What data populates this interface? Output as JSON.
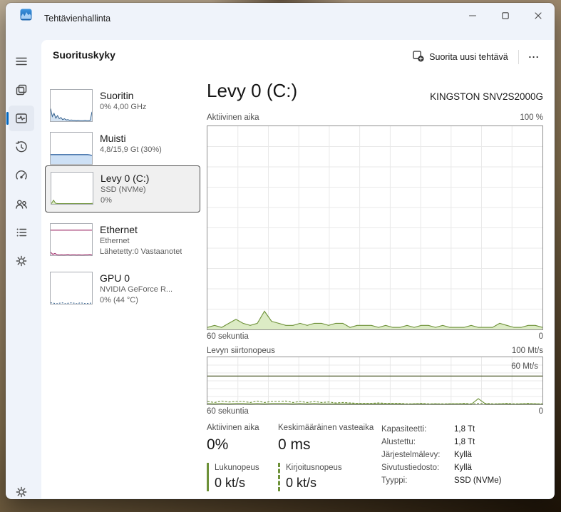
{
  "titlebar": {
    "title": "Tehtävienhallinta"
  },
  "window_controls": [
    "minimize",
    "maximize",
    "close"
  ],
  "header": {
    "title": "Suorituskyky",
    "run_new_task_label": "Suorita uusi tehtävä",
    "more_label": "..."
  },
  "sidebar": {
    "items": [
      "menu",
      "processes",
      "performance",
      "app-history",
      "startup-apps",
      "users",
      "details",
      "services"
    ],
    "bottom": "settings",
    "selected": "performance"
  },
  "perf_list": [
    {
      "name": "Suoritin",
      "line2": "0% 4,00 GHz",
      "type": "cpu",
      "spark": [
        40,
        15,
        25,
        10,
        18,
        8,
        12,
        5,
        8,
        4,
        5,
        3,
        4,
        3,
        3,
        2,
        3,
        2,
        2,
        2,
        3,
        2,
        2,
        3,
        30
      ]
    },
    {
      "name": "Muisti",
      "line2": "4,8/15,9 Gt (30%)",
      "type": "memory",
      "spark": [
        30,
        30,
        30,
        30,
        30,
        30,
        30,
        30,
        30,
        30,
        30,
        30,
        30,
        30,
        30,
        30,
        30,
        30,
        29,
        27
      ]
    },
    {
      "name": "Levy 0 (C:)",
      "line2": "SSD (NVMe)",
      "line3": "0%",
      "type": "disk",
      "selected": true,
      "spark": [
        1,
        12,
        2,
        1,
        1,
        1,
        1,
        1,
        1,
        1,
        1,
        1,
        1,
        1,
        1,
        1,
        1,
        1,
        1,
        2
      ]
    },
    {
      "name": "Ethernet",
      "line2": "Ethernet",
      "line3": "Lähetetty:0 Vastaanotet",
      "type": "ethernet",
      "topline": 80,
      "spark": [
        10,
        3,
        6,
        2,
        1,
        2,
        1,
        2,
        3,
        1,
        2,
        2,
        1,
        2,
        1,
        1,
        2,
        2,
        3,
        1
      ]
    },
    {
      "name": "GPU 0",
      "line2": "NVIDIA GeForce R...",
      "line3": "0% (44 °C)",
      "type": "gpu",
      "spark": [
        3,
        2,
        0,
        2,
        3,
        0,
        2,
        3,
        2,
        0,
        3,
        2,
        0,
        2,
        2
      ]
    }
  ],
  "main": {
    "title": "Levy 0 (C:)",
    "device": "KINGSTON SNV2S2000G",
    "stats": {
      "active_time": {
        "label": "Aktiivinen aika",
        "value": "0%"
      },
      "avg_response": {
        "label": "Keskimääräinen vasteaika",
        "value": "0 ms"
      },
      "read_speed": {
        "label": "Lukunopeus",
        "value": "0 kt/s"
      },
      "write_speed": {
        "label": "Kirjoitusnopeus",
        "value": "0 kt/s"
      },
      "details": [
        {
          "label": "Kapasiteetti:",
          "value": "1,8 Tt"
        },
        {
          "label": "Alustettu:",
          "value": "1,8 Tt"
        },
        {
          "label": "Järjestelmälevy:",
          "value": "Kyllä"
        },
        {
          "label": "Sivutustiedosto:",
          "value": "Kyllä"
        },
        {
          "label": "Tyyppi:",
          "value": "SSD (NVMe)"
        }
      ]
    }
  },
  "chart_data": [
    {
      "type": "area",
      "title": "Aktiivinen aika",
      "ylim": [
        0,
        100
      ],
      "y_max_label": "100 %",
      "x_left_label": "60 sekuntia",
      "x_right_label": "0",
      "grid": true,
      "series": [
        {
          "name": "Aktiivinen aika %",
          "values": [
            1,
            2,
            1,
            3,
            5,
            3,
            2,
            3,
            9,
            4,
            3,
            2,
            2,
            3,
            2,
            3,
            3,
            2,
            3,
            3,
            1,
            2,
            2,
            2,
            1,
            2,
            1,
            1,
            2,
            1,
            2,
            2,
            1,
            2,
            1,
            1,
            1,
            2,
            1,
            1,
            1,
            3,
            2,
            1,
            1,
            2,
            2,
            1
          ]
        }
      ]
    },
    {
      "type": "line",
      "title": "Levyn siirtonopeus",
      "ylim": [
        0,
        100
      ],
      "y_max_label": "100 Mt/s",
      "scale_line": {
        "value": 60,
        "label": "60 Mt/s"
      },
      "x_left_label": "60 sekuntia",
      "x_right_label": "0",
      "grid": true,
      "series": [
        {
          "name": "Lukunopeus",
          "style": "solid",
          "values": [
            2,
            1,
            2,
            1,
            2,
            2,
            1,
            2,
            1,
            2,
            2,
            2,
            1,
            2,
            1,
            2,
            1,
            1,
            1,
            1,
            1,
            1,
            1,
            1,
            1,
            1,
            1,
            1,
            0,
            1,
            1,
            0,
            1,
            0,
            1,
            1,
            1,
            0,
            12,
            1,
            0,
            1,
            1,
            0,
            1,
            1,
            1,
            0
          ]
        },
        {
          "name": "Kirjoitusnopeus",
          "style": "dashed",
          "values": [
            6,
            4,
            7,
            5,
            6,
            6,
            4,
            7,
            4,
            6,
            6,
            7,
            4,
            6,
            4,
            6,
            4,
            5,
            3,
            4,
            3,
            2,
            2,
            2,
            3,
            2,
            2,
            2,
            1,
            1,
            2,
            1,
            1,
            1,
            1,
            1,
            2,
            1,
            2,
            2,
            1,
            1,
            2,
            1,
            1,
            2,
            1,
            1
          ]
        }
      ]
    }
  ],
  "colors": {
    "accent": "#0067c0",
    "disk_green": "#6d9138",
    "disk_green_fill": "#dcebc5",
    "scale_line": "#4a5626",
    "cpu_blue": "#35628f",
    "cpu_fill": "#d4e3f2",
    "mem_line": "#4f7bb0",
    "mem_fill": "#cde0f5",
    "eth_magenta": "#a3346f",
    "eth_fill": "#f2dce8",
    "grid": "#e9e9e9",
    "chart_border": "#8f8f8f"
  }
}
